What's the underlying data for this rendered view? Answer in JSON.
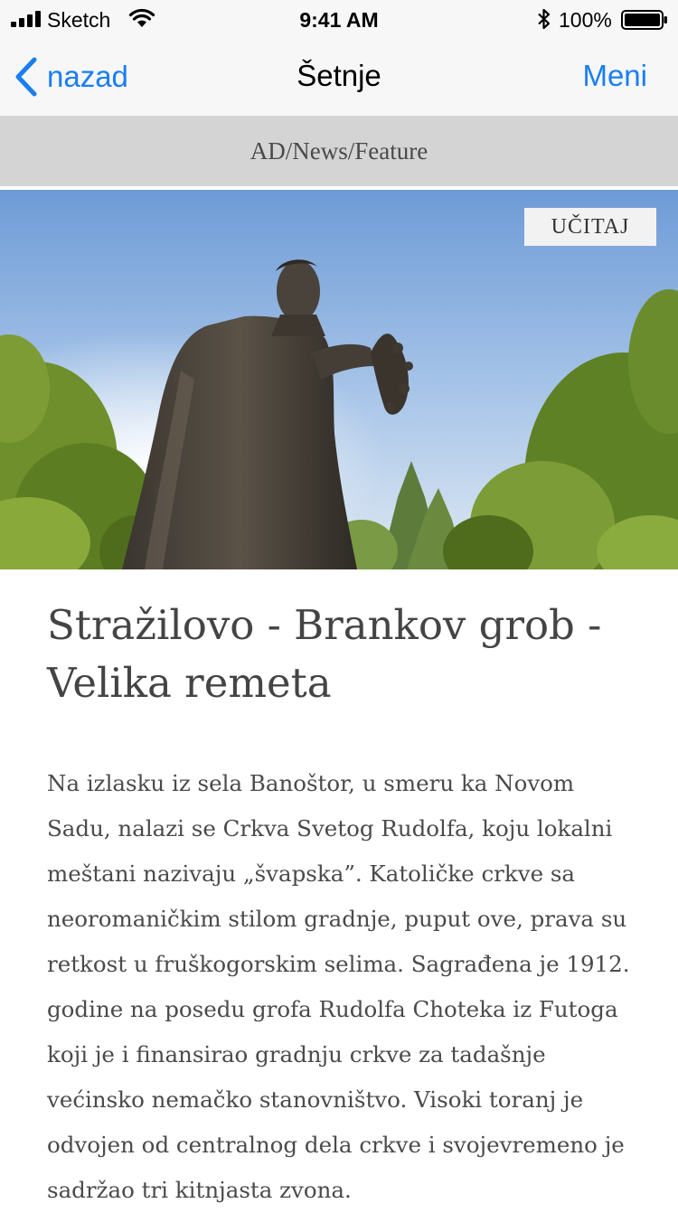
{
  "status_bar": {
    "carrier": "Sketch",
    "time": "9:41 AM",
    "battery": "100%",
    "icons": [
      "signal-icon",
      "wifi-icon",
      "bluetooth-icon",
      "battery-icon"
    ]
  },
  "nav": {
    "back_label": "nazad",
    "title": "Šetnje",
    "menu_label": "Meni",
    "accent_color": "#1a7ef2",
    "back_icon": "chevron-left-icon"
  },
  "ad": {
    "label": "AD/News/Feature"
  },
  "hero": {
    "load_button": "UČITAJ"
  },
  "article": {
    "title": "Stražilovo - Brankov grob - Velika remeta",
    "body": "Na izlasku iz sela Banoštor, u smeru ka Novom Sadu, nalazi se Crkva Svetog Rudolfa, koju lokalni meštani nazivaju „švapska”. Katoličke crkve sa neoromaničkim stilom gradnje, puput ove, prava su retkost u fruškogorskim selima. Sagrađena je 1912. godine na posedu grofa Rudolfa Choteka iz Futoga koji je i finansirao gradnju crkve za tadašnje većinsko nemačko stanovništvo. Visoki toranj je odvojen od centralnog dela crkve i svojevremeno je sadržao tri kitnjasta zvona."
  }
}
